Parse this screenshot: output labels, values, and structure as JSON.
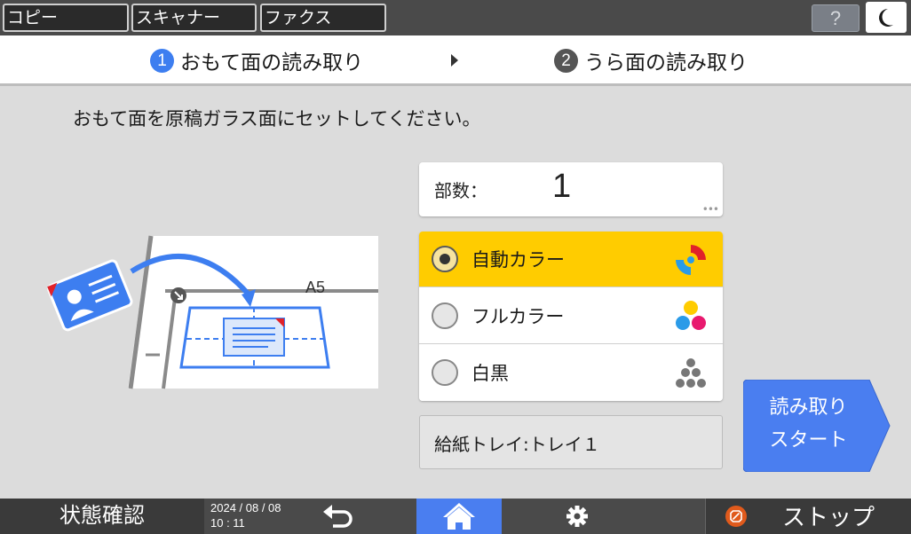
{
  "topbar": {
    "tabs": [
      "コピー",
      "スキャナー",
      "ファクス"
    ],
    "help_label": "?"
  },
  "steps": {
    "step1": {
      "number": "1",
      "label": "おもて面の読み取り"
    },
    "step2": {
      "number": "2",
      "label": "うら面の読み取り"
    }
  },
  "instruction": "おもて面を原稿ガラス面にセットしてください。",
  "illustration": {
    "paper_size": "A5"
  },
  "copies": {
    "label": "部数：",
    "value": "1",
    "more": "•••"
  },
  "color_options": [
    {
      "label": "自動カラー",
      "selected": true
    },
    {
      "label": "フルカラー",
      "selected": false
    },
    {
      "label": "白黒",
      "selected": false
    }
  ],
  "tray": {
    "text": "給紙トレイ:トレイ１"
  },
  "start_button": {
    "label": "読み取り\nスタート"
  },
  "bottombar": {
    "status_label": "状態確認",
    "date": "2024 / 08 / 08",
    "time": "10 : 11",
    "stop_label": "ストップ"
  },
  "colors": {
    "accent_blue": "#3d7ef0",
    "selected_yellow": "#ffcc00",
    "bar_gray": "#4a4a4a"
  }
}
